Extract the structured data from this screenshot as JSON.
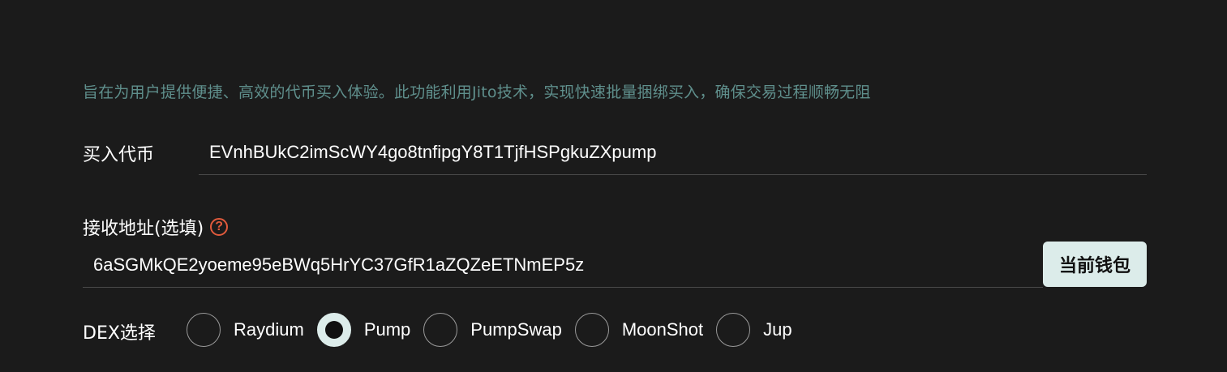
{
  "description": "旨在为用户提供便捷、高效的代币买入体验。此功能利用Jito技术，实现快速批量捆绑买入，确保交易过程顺畅无阻",
  "token": {
    "label": "买入代币",
    "value": "EVnhBUkC2imScWY4go8tnfipgY8T1TjfHSPgkuZXpump"
  },
  "address": {
    "label": "接收地址(选填)",
    "help_icon": "question-circle-icon",
    "help_glyph": "?",
    "value": "6aSGMkQE2yoeme95eBWq5HrYC37GfR1aZQZeETNmEP5z",
    "wallet_button": "当前钱包"
  },
  "dex": {
    "label": "DEX选择",
    "options": [
      "Raydium",
      "Pump",
      "PumpSwap",
      "MoonShot",
      "Jup"
    ],
    "selected": "Pump"
  },
  "colors": {
    "background": "#1b1b1b",
    "description_text": "#5f8f8c",
    "accent_button": "#dcecea",
    "help_icon": "#e05a3c"
  }
}
